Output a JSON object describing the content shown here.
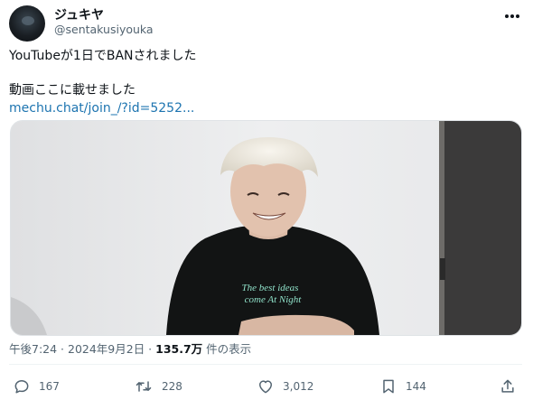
{
  "author": {
    "display_name": "ジュキヤ",
    "handle": "@sentakusiyouka",
    "avatar_icon": "avatar-image"
  },
  "tweet": {
    "line1": "YouTubeが1日でBANされました",
    "line2": "動画ここに載せました",
    "link": "mechu.chat/join_/?id=5252..."
  },
  "media": {
    "shirt_text_line1": "The best ideas",
    "shirt_text_line2": "come At Night"
  },
  "meta": {
    "timestamp": "午後7:24 · 2024年9月2日 · ",
    "views_count": "135.7万",
    "views_label": " 件の表示"
  },
  "actions": {
    "replies": "167",
    "retweets": "228",
    "likes": "3,012",
    "bookmarks": "144"
  },
  "colors": {
    "link": "#1d74b0",
    "muted": "#536471",
    "text": "#0f1419"
  }
}
